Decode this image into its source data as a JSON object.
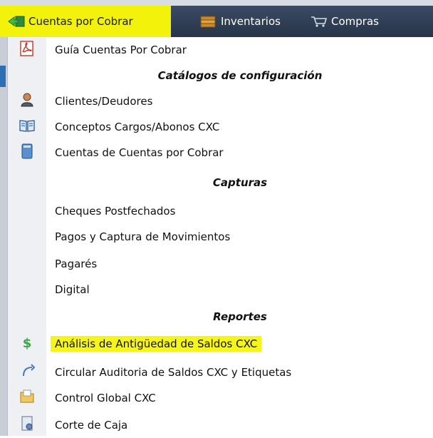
{
  "menubar": {
    "tabs": [
      {
        "label": "Cuentas por Cobrar",
        "icon": "exit-arrow-icon",
        "active": true
      },
      {
        "label": "Inventarios",
        "icon": "box-icon",
        "active": false
      },
      {
        "label": "Compras",
        "icon": "cart-icon",
        "active": false
      }
    ]
  },
  "dropdown": {
    "items": [
      {
        "kind": "item",
        "label": "Guía Cuentas Por Cobrar",
        "icon": "pdf-icon"
      },
      {
        "kind": "section",
        "label": "Catálogos de configuración"
      },
      {
        "kind": "item",
        "label": "Clientes/Deudores",
        "icon": "user-icon"
      },
      {
        "kind": "item",
        "label": "Conceptos Cargos/Abonos CXC",
        "icon": "book-icon"
      },
      {
        "kind": "item",
        "label": "Cuentas de Cuentas por Cobrar",
        "icon": "ledger-icon"
      },
      {
        "kind": "section",
        "label": "Capturas"
      },
      {
        "kind": "item",
        "label": "Cheques Postfechados",
        "icon": ""
      },
      {
        "kind": "item",
        "label": "Pagos y Captura de Movimientos",
        "icon": ""
      },
      {
        "kind": "item",
        "label": "Pagarés",
        "icon": ""
      },
      {
        "kind": "item",
        "label": "Digital",
        "icon": ""
      },
      {
        "kind": "section",
        "label": "Reportes"
      },
      {
        "kind": "item",
        "label": "Análisis de Antigüedad de Saldos CXC",
        "icon": "dollar-icon",
        "highlighted": true
      },
      {
        "kind": "item",
        "label": "Circular Auditoria de Saldos CXC y Etiquetas",
        "icon": "arrow-icon"
      },
      {
        "kind": "item",
        "label": "Control Global CXC",
        "icon": "folder-icon"
      },
      {
        "kind": "item",
        "label": "Corte de Caja",
        "icon": "document-icon"
      }
    ]
  },
  "colors": {
    "menubar_bg": "#2f3d55",
    "active_tab_highlight": "#f2f20a",
    "item_highlight": "#f5f51a"
  }
}
